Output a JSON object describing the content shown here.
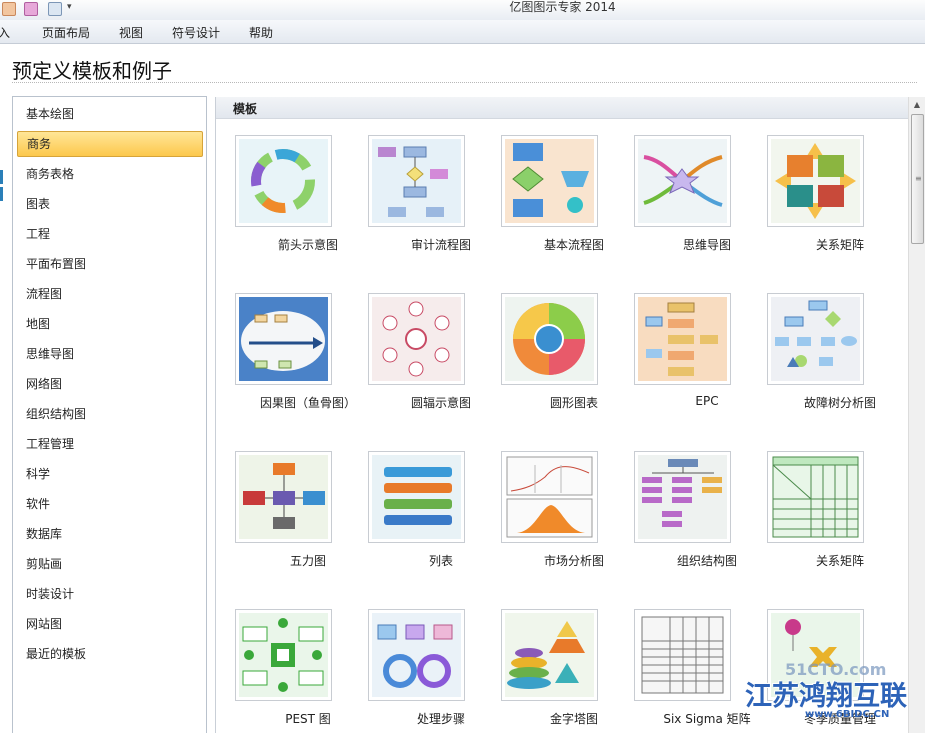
{
  "app": {
    "title": "亿图图示专家 2014"
  },
  "quick_access": {
    "icons": [
      "save-icon",
      "print-icon",
      "preview-icon"
    ],
    "dropdown_glyph": "▾"
  },
  "menu": {
    "items": [
      "入",
      "页面布局",
      "视图",
      "符号设计",
      "帮助"
    ]
  },
  "page": {
    "title": "预定义模板和例子"
  },
  "categories": {
    "items": [
      "基本绘图",
      "商务",
      "商务表格",
      "图表",
      "工程",
      "平面布置图",
      "流程图",
      "地图",
      "思维导图",
      "网络图",
      "组织结构图",
      "工程管理",
      "科学",
      "软件",
      "数据库",
      "剪贴画",
      "时装设计",
      "网站图",
      "最近的模板"
    ],
    "selected": "商务"
  },
  "templates": {
    "header": "模板",
    "items": [
      {
        "label": "箭头示意图"
      },
      {
        "label": "审计流程图"
      },
      {
        "label": "基本流程图"
      },
      {
        "label": "思维导图"
      },
      {
        "label": "关系矩阵"
      },
      {
        "label": "因果图（鱼骨图）"
      },
      {
        "label": "圆辐示意图"
      },
      {
        "label": "圆形图表"
      },
      {
        "label": "EPC"
      },
      {
        "label": "故障树分析图"
      },
      {
        "label": "五力图"
      },
      {
        "label": "列表"
      },
      {
        "label": "市场分析图"
      },
      {
        "label": "组织结构图"
      },
      {
        "label": "关系矩阵"
      },
      {
        "label": "PEST 图"
      },
      {
        "label": "处理步骤"
      },
      {
        "label": "金字塔图"
      },
      {
        "label": "Six Sigma 矩阵"
      },
      {
        "label": "冬季质量管理"
      }
    ]
  },
  "watermark": {
    "top": "51CTO.com",
    "main": "江苏鸿翔互联",
    "url": "www.6BIDC.CN"
  },
  "colors": {
    "selected_bg": "#fcc84d",
    "watermark": "#2d63b8"
  }
}
